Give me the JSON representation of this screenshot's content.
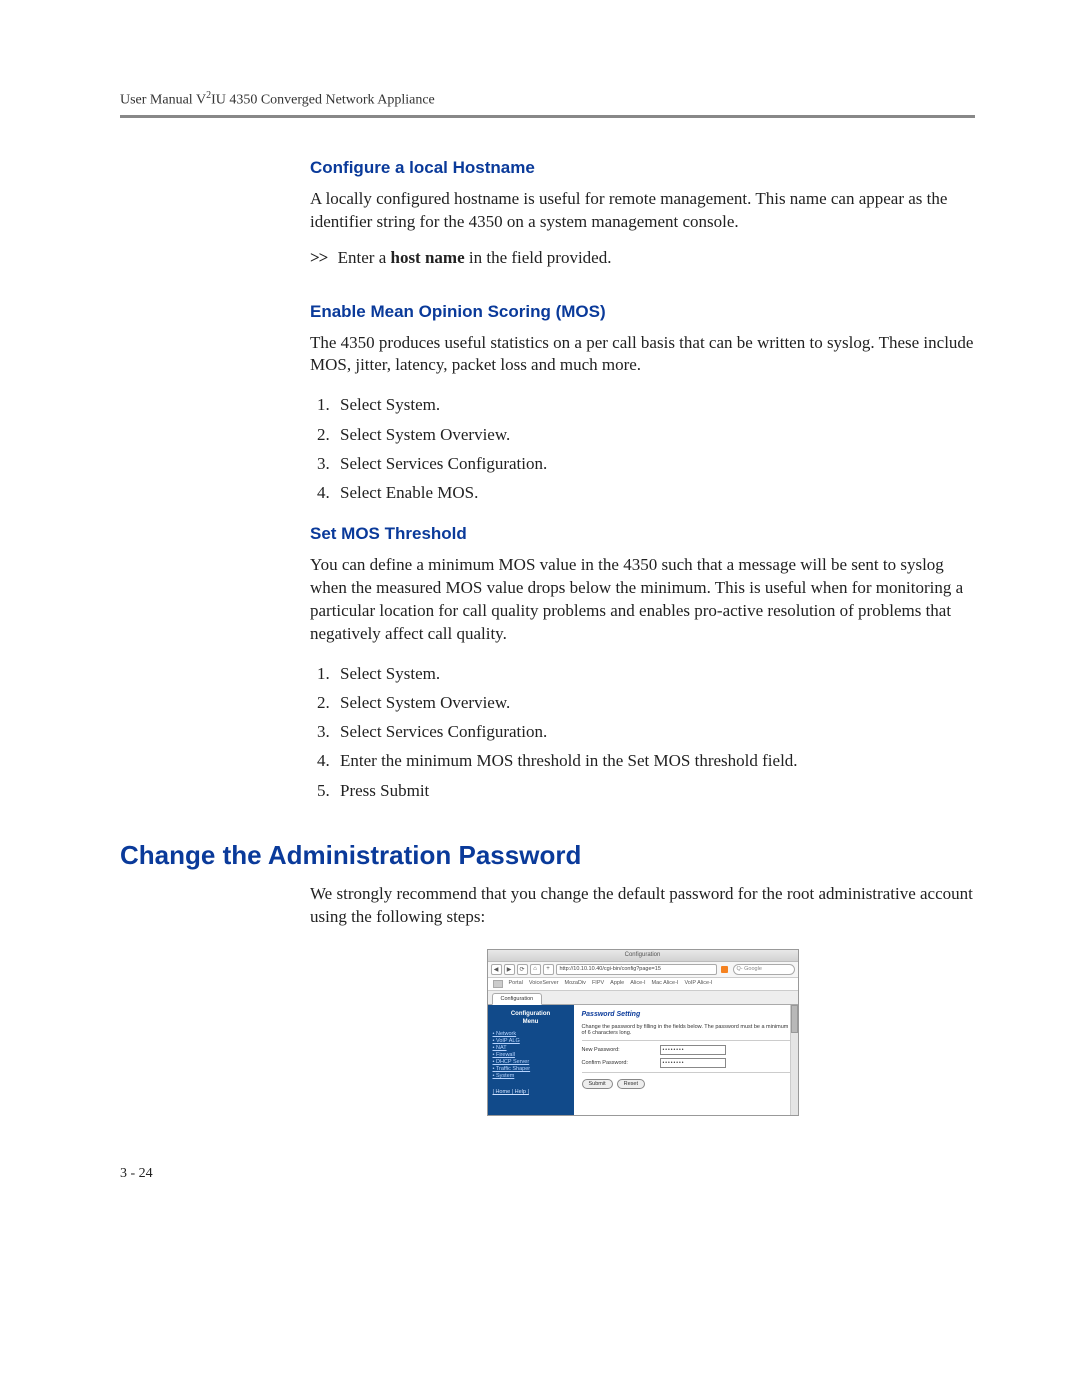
{
  "header": {
    "running_head_prefix": "User Manual V",
    "running_head_sup": "2",
    "running_head_suffix": "IU 4350 Converged Network Appliance"
  },
  "sec1": {
    "title": "Configure a local Hostname",
    "p1": "A locally configured hostname is useful for remote management. This name can appear as the identifier string for the 4350 on a system management console.",
    "step_prefix": ">>",
    "step_before": "Enter a ",
    "step_bold": "host name",
    "step_after": " in the field provided."
  },
  "sec2": {
    "title": "Enable Mean Opinion Scoring (MOS)",
    "p1": "The 4350 produces useful statistics on a per call basis that can be written to syslog. These include MOS, jitter, latency, packet loss and much more.",
    "steps": [
      "Select System.",
      "Select System Overview.",
      "Select Services Configuration.",
      "Select Enable MOS."
    ]
  },
  "sec3": {
    "title": "Set MOS Threshold",
    "p1": "You can define a minimum MOS value in the 4350 such that a message will be sent to syslog when the measured MOS value drops below the minimum. This is useful when for monitoring a particular location for call quality problems and enables pro-active resolution of problems that negatively affect call quality.",
    "steps": [
      "Select System.",
      "Select System Overview.",
      "Select Services Configuration.",
      "Enter the minimum MOS threshold in the Set MOS threshold field.",
      "Press Submit"
    ]
  },
  "sec4": {
    "title": "Change the Administration Password",
    "p1": "We strongly recommend that you change the default password for the root administrative account using the following steps:"
  },
  "shot": {
    "window_title": "Configuration",
    "nav_back": "◀",
    "nav_fwd": "▶",
    "nav_reload": "⟳",
    "nav_home": "⌂",
    "nav_add": "+",
    "url": "http://10.10.10.40/cgi-bin/config?page=15",
    "search_placeholder": "Q- Google",
    "menu_items": [
      "Portal",
      "VoiceServer",
      "MozaDiv",
      "FIPV",
      "Apple",
      "Alice-I",
      "Mac Alice-I",
      "VoIP Alice-I"
    ],
    "tab": "Configuration",
    "side_title1": "Configuration",
    "side_title2": "Menu",
    "side_links": [
      "Network",
      "VoIP ALG",
      "NAT",
      "Firewall",
      "DHCP Server",
      "Traffic Shaper",
      "System"
    ],
    "side_footer": "| Home | Help |",
    "panel_title": "Password Setting",
    "panel_desc": "Change the password by filling in the fields below. The password must be a minimum of 6 characters long.",
    "lbl_new": "New Password:",
    "lbl_confirm": "Confirm Password:",
    "val_mask": "••••••••",
    "btn_submit": "Submit",
    "btn_reset": "Reset"
  },
  "page_number": "3 - 24"
}
